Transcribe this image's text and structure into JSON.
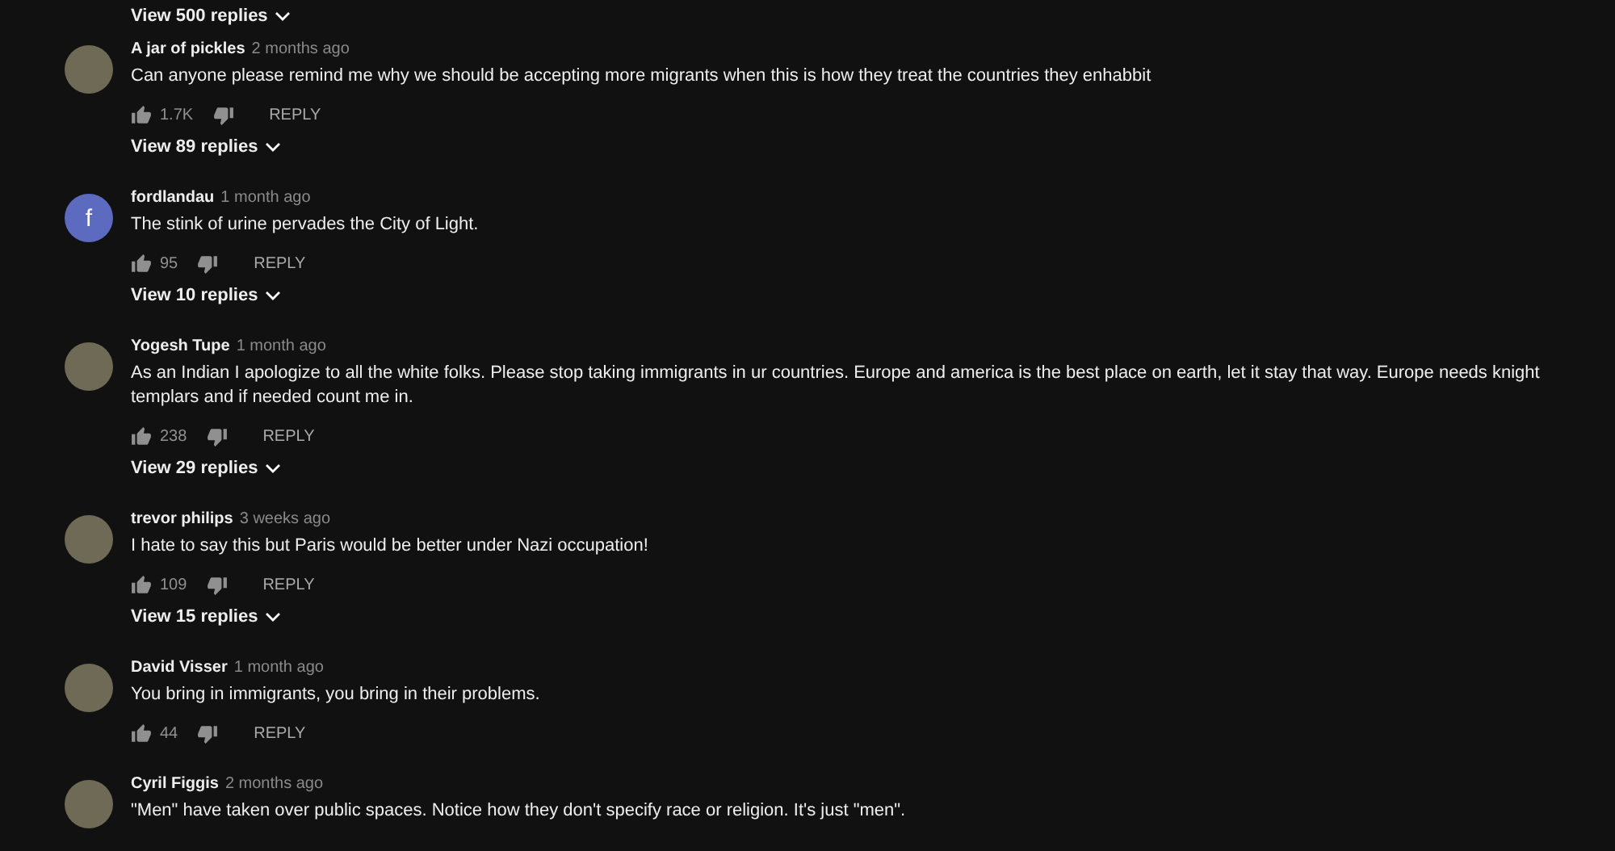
{
  "top_replies": {
    "label": "View 500 replies"
  },
  "comments": [
    {
      "author": "A jar of pickles",
      "time": "2 months ago",
      "avatar": {
        "kind": "image"
      },
      "text": "Can anyone please remind me why we should be accepting more migrants when this is how they treat the countries they enhabbit",
      "likes": "1.7K",
      "reply": "REPLY",
      "view_replies": "View 89 replies"
    },
    {
      "author": "fordlandau",
      "time": "1 month ago",
      "avatar": {
        "kind": "letter",
        "letter": "f",
        "color": "#5c6bc0"
      },
      "text": "The stink of urine pervades the City of Light.",
      "likes": "95",
      "reply": "REPLY",
      "view_replies": "View 10 replies"
    },
    {
      "author": "Yogesh Tupe",
      "time": "1 month ago",
      "avatar": {
        "kind": "image"
      },
      "text": "As an Indian I apologize to all the white folks. Please stop taking immigrants in ur countries. Europe and america is the best place on earth, let it stay that way. Europe needs knight templars and if needed count me in.",
      "likes": "238",
      "reply": "REPLY",
      "view_replies": "View 29 replies"
    },
    {
      "author": "trevor philips",
      "time": "3 weeks ago",
      "avatar": {
        "kind": "image"
      },
      "text": "I hate to say this but Paris would be better under Nazi occupation!",
      "likes": "109",
      "reply": "REPLY",
      "view_replies": "View 15 replies"
    },
    {
      "author": "David Visser",
      "time": "1 month ago",
      "avatar": {
        "kind": "image"
      },
      "text": "You bring in immigrants, you bring in their problems.",
      "likes": "44",
      "reply": "REPLY"
    },
    {
      "author": "Cyril Figgis",
      "time": "2 months ago",
      "avatar": {
        "kind": "image"
      },
      "text": "\"Men\" have taken over public spaces.  Notice how they don't specify race or religion.  It's just \"men\"."
    }
  ]
}
